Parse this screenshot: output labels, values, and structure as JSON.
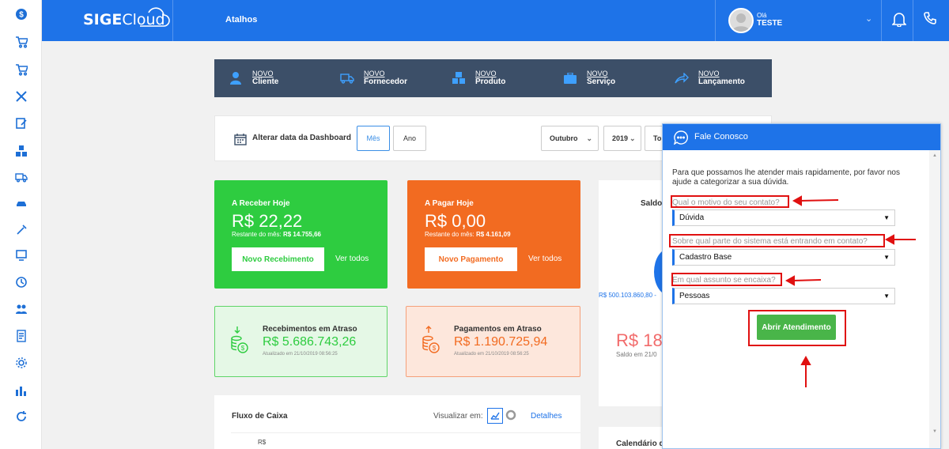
{
  "topbar": {
    "logo_sige": "SIGE",
    "logo_cloud": "Cloud",
    "atalhos": "Atalhos",
    "user_greeting": "Olá",
    "user_name": "TESTE"
  },
  "sidebar": {
    "icons": [
      "dollar-icon",
      "cart-in-icon",
      "cart-out-icon",
      "tools-icon",
      "edit-icon",
      "boxes-icon",
      "truck-icon",
      "car-icon",
      "wrench-icon",
      "monitor-icon",
      "clock-icon",
      "users-icon",
      "document-icon",
      "gear-icon",
      "bar-chart-icon",
      "refresh-icon"
    ]
  },
  "shortcuts": [
    {
      "pre": "NOVO",
      "label": "Cliente",
      "icon": "person-icon"
    },
    {
      "pre": "NOVO",
      "label": "Fornecedor",
      "icon": "truck-icon"
    },
    {
      "pre": "NOVO",
      "label": "Produto",
      "icon": "boxes-icon"
    },
    {
      "pre": "NOVO",
      "label": "Serviço",
      "icon": "briefcase-icon"
    },
    {
      "pre": "NOVO",
      "label": "Lançamento",
      "icon": "share-icon"
    }
  ],
  "datebar": {
    "label": "Alterar data da Dashboard",
    "mes": "Mês",
    "ano": "Ano",
    "month": "Outubro",
    "year": "2019",
    "partial": "To"
  },
  "receber": {
    "title": "A Receber Hoje",
    "value": "R$ 22,22",
    "sub_label": "Restante do mês:",
    "sub_value": "R$ 14.755,66",
    "button": "Novo Recebimento",
    "link": "Ver todos"
  },
  "pagar": {
    "title": "A Pagar Hoje",
    "value": "R$ 0,00",
    "sub_label": "Restante do mês:",
    "sub_value": "R$ 4.161,09",
    "button": "Novo Pagamento",
    "link": "Ver todos"
  },
  "rec_atraso": {
    "title": "Recebimentos em Atraso",
    "value": "R$ 5.686.743,26",
    "updated": "Atualizado em 21/10/2019 08:56:25"
  },
  "pag_atraso": {
    "title": "Pagamentos em Atraso",
    "value": "R$ 1.190.725,94",
    "updated": "Atualizado em 21/10/2019 08:56:25"
  },
  "saldo": {
    "title": "Saldo",
    "value_partial": "R$ 500.103.860,80 -",
    "big": "R$ 18",
    "sub": "Saldo em 21/0"
  },
  "fluxo": {
    "title": "Fluxo de Caixa",
    "visualizar": "Visualizar em:",
    "detalhes": "Detalhes",
    "axis": "R$"
  },
  "calendario": {
    "title": "Calendário d"
  },
  "chat": {
    "title": "Fale Conosco",
    "intro": "Para que possamos lhe atender mais rapidamente, por favor nos ajude a categorizar a sua dúvida.",
    "q1": "Qual o motivo do seu contato?",
    "a1": "Dúvida",
    "q2": "Sobre qual parte do sistema está entrando em contato?",
    "a2": "Cadastro Base",
    "q3": "Em qual assunto se encaixa?",
    "a3": "Pessoas",
    "button": "Abrir Atendimento"
  },
  "colors": {
    "primary": "#1e73e8",
    "green": "#2ecc40",
    "orange": "#f26b21",
    "navy": "#3c4f68",
    "annotation": "#e01010"
  }
}
